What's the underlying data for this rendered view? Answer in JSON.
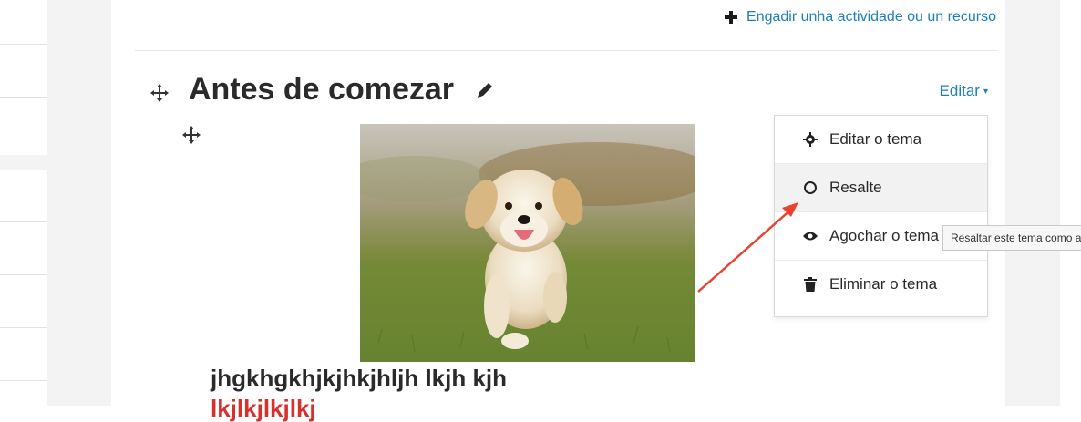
{
  "header": {
    "add_activity_label": "Engadir unha actividade ou un recurso"
  },
  "section": {
    "title": "Antes de comezar",
    "edit_label": "Editar"
  },
  "edit_menu": {
    "items": [
      {
        "label": "Editar o tema",
        "icon": "gear-icon"
      },
      {
        "label": "Resalte",
        "icon": "circle-icon"
      },
      {
        "label": "Agochar o tema",
        "icon": "eye-icon"
      },
      {
        "label": "Eliminar o tema",
        "icon": "trash-icon"
      }
    ],
    "tooltip": "Resaltar este tema como actual"
  },
  "content": {
    "text_line": "jhgkhgkhjkjhkjhljh lkjh kjh",
    "red_line": "lkjlkjlkjlkj"
  },
  "colors": {
    "link": "#1e7fb8",
    "annotation_arrow": "#e8432e",
    "red_text": "#d9302c"
  }
}
